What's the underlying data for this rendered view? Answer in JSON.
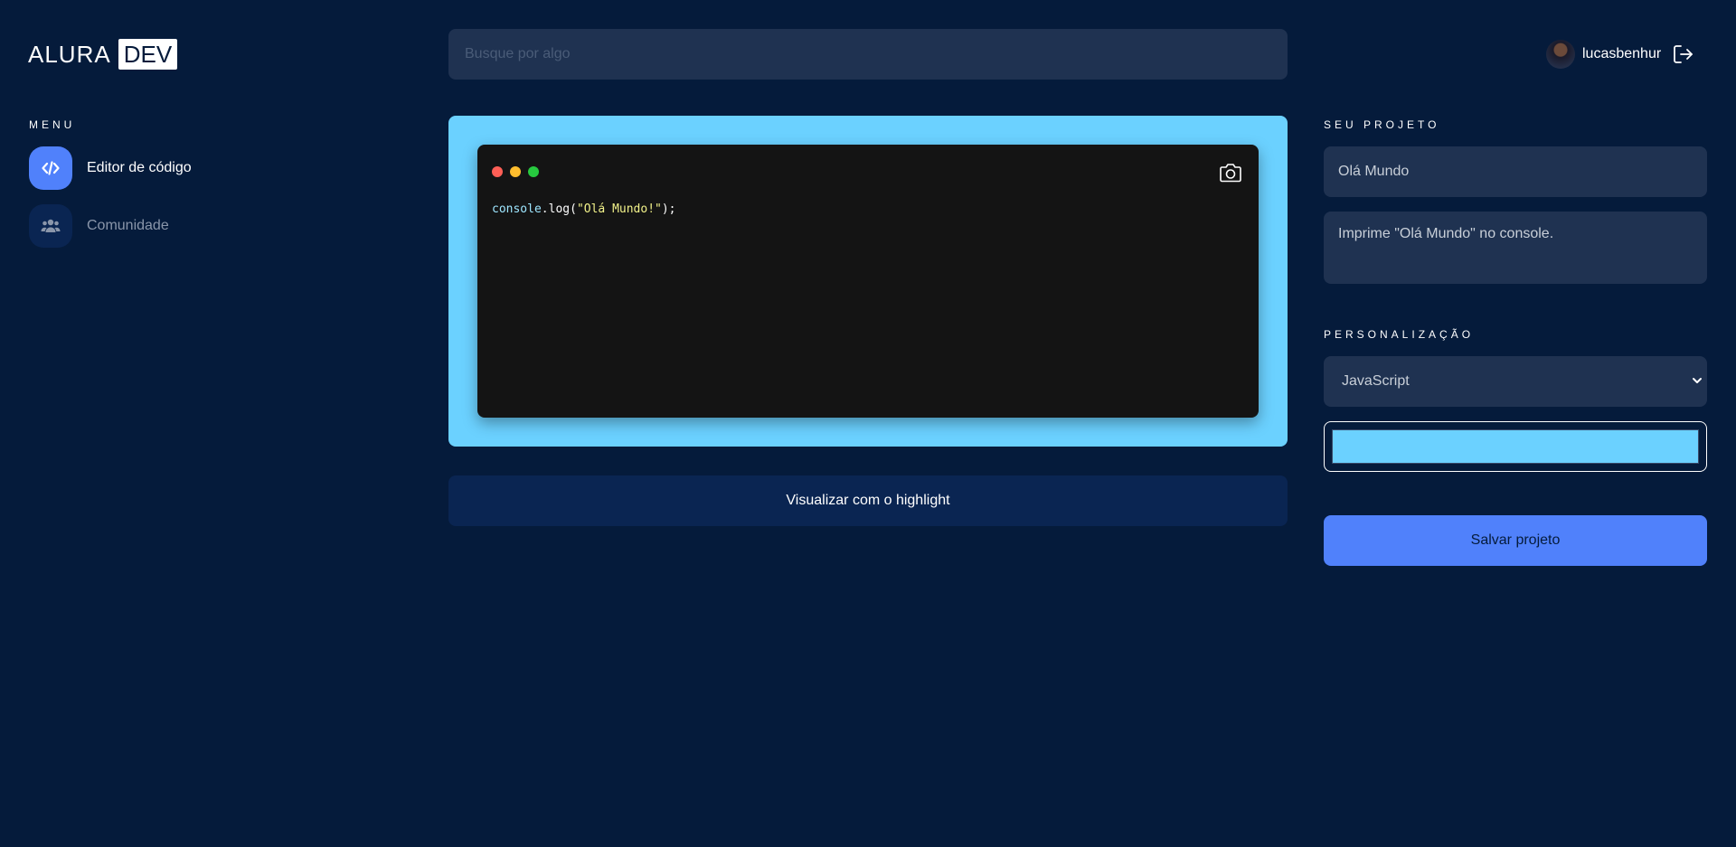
{
  "logo": {
    "text": "ALURA",
    "badge": "DEV"
  },
  "search": {
    "placeholder": "Busque por algo",
    "value": ""
  },
  "user": {
    "username": "lucasbenhur",
    "avatar_icon": "user-avatar",
    "logout_icon": "logout-icon"
  },
  "menu": {
    "title": "MENU",
    "items": [
      {
        "label": "Editor de código",
        "icon": "code-icon",
        "active": true
      },
      {
        "label": "Comunidade",
        "icon": "users-icon",
        "active": false
      }
    ]
  },
  "editor": {
    "window_dots": [
      "#ff5f56",
      "#ffbd2e",
      "#27c93f"
    ],
    "code": {
      "object": "console",
      "punct1": ".log(",
      "string": "\"Olá Mundo!\"",
      "punct2": ");"
    },
    "background_color": "#6bd1ff",
    "camera_icon": "camera-icon"
  },
  "highlight_button": {
    "label": "Visualizar com o highlight"
  },
  "project": {
    "title": "SEU PROJETO",
    "name": "Olá Mundo",
    "description": "Imprime \"Olá Mundo\" no console."
  },
  "customization": {
    "title": "PERSONALIZAÇÃO",
    "language": "JavaScript",
    "color": "#6bd1ff"
  },
  "save_button": {
    "label": "Salvar projeto"
  },
  "colors": {
    "background": "#051b3b",
    "accent": "#5081fb",
    "field": "#1f3251",
    "dark_button": "#0a2552"
  }
}
